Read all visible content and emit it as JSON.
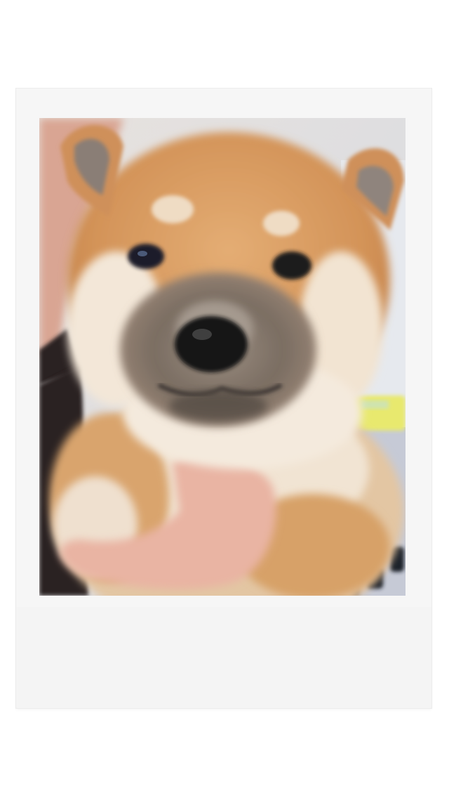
{
  "image": {
    "subject": "shiba-inu-puppy",
    "frame_style": "instant-film-polaroid",
    "colors": {
      "page_background": "#ffffff",
      "frame": "#f6f6f6",
      "fur_orange": "#d69a5f",
      "fur_cream": "#f2e6d6",
      "muzzle_grey": "#6e6660",
      "nose": "#151515",
      "hand_skin": "#e8b3a3",
      "background_blue": "#c8ccd6",
      "yellow_object": "#e7e86c"
    }
  }
}
